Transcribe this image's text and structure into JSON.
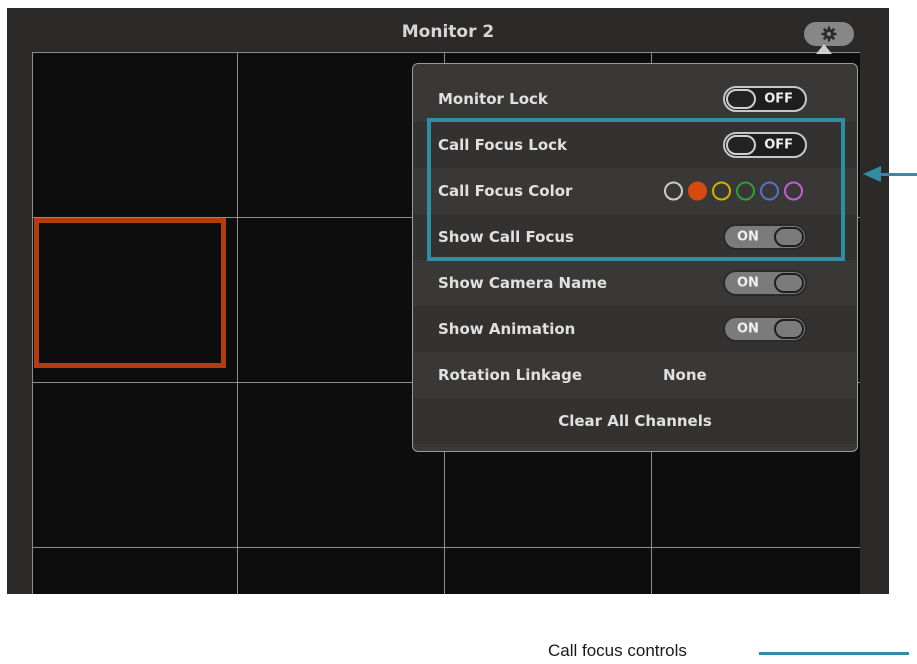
{
  "monitor": {
    "title": "Monitor 2"
  },
  "settings_button": {
    "icon": "gear-icon"
  },
  "panel": {
    "monitor_lock": {
      "label": "Monitor Lock",
      "state": "OFF"
    },
    "call_focus_lock": {
      "label": "Call Focus Lock",
      "state": "OFF"
    },
    "call_focus_color": {
      "label": "Call Focus Color",
      "options": [
        "#cccccc",
        "#d64a10",
        "#c9b400",
        "#2f9e3a",
        "#5a6fc9",
        "#c05fd0"
      ],
      "selected_index": 1
    },
    "show_call_focus": {
      "label": "Show Call Focus",
      "state": "ON"
    },
    "show_camera_name": {
      "label": "Show Camera Name",
      "state": "ON"
    },
    "show_animation": {
      "label": "Show Animation",
      "state": "ON"
    },
    "rotation_linkage": {
      "label": "Rotation Linkage",
      "value": "None"
    },
    "clear_all": {
      "label": "Clear All Channels"
    }
  },
  "annotation": {
    "caption": "Call focus controls",
    "color": "#2f8ea3"
  },
  "colors": {
    "focus_border": "#b43d0f",
    "panel_bg": "#393837"
  }
}
